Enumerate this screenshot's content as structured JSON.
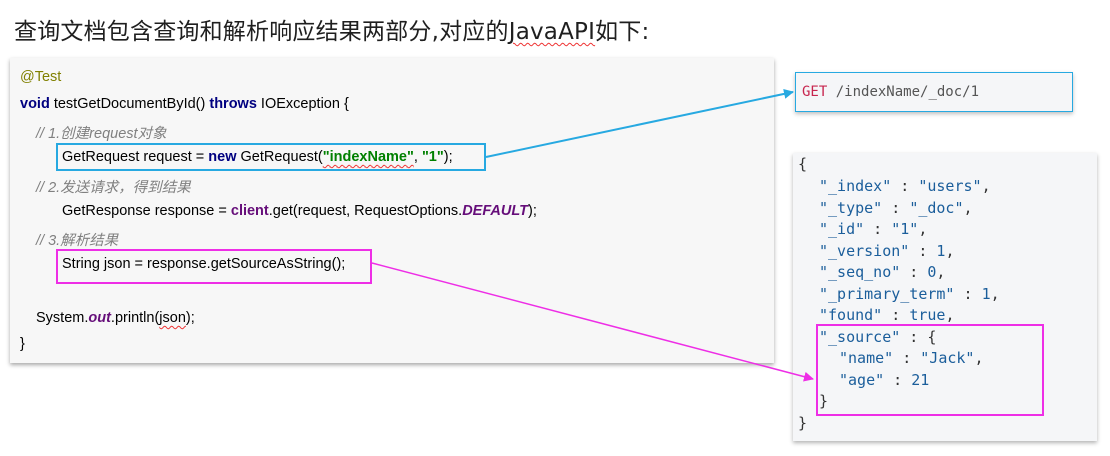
{
  "title": {
    "prefix": "查询文档包含查询和解析响应结果两部分,对应的",
    "api": "JavaAPI",
    "suffix": "如下:"
  },
  "code": {
    "annotation": "@Test",
    "kw_void": "void",
    "method_sig": " testGetDocumentById() ",
    "kw_throws": "throws",
    "exception": " IOException {",
    "comment1": "// 1.创建request对象",
    "l4_a": "GetRequest request = ",
    "kw_new": "new",
    "l4_b": " GetRequest(",
    "str_index": "\"indexName\"",
    "l4_c": ", ",
    "str_one": "\"1\"",
    "l4_d": ");",
    "comment2": "// 2.发送请求，得到结果",
    "l6_a": "GetResponse response = ",
    "l6_client": "client",
    "l6_b": ".get(request, RequestOptions.",
    "l6_default": "DEFAULT",
    "l6_c": ");",
    "comment3": "// 3.解析结果",
    "l8": "String json = response.getSourceAsString();",
    "l10_a": "System.",
    "l10_out": "out",
    "l10_b": ".println(",
    "l10_json": "json",
    "l10_c": ");",
    "close": "}"
  },
  "request": {
    "method": "GET",
    "path": " /indexName/_doc/1"
  },
  "response": {
    "open": "{",
    "index_key": "\"_index\"",
    "index_val": "\"users\"",
    "type_key": "\"_type\"",
    "type_val": "\"_doc\"",
    "id_key": "\"_id\"",
    "id_val": "\"1\"",
    "version_key": "\"_version\"",
    "version_val": "1",
    "seq_key": "\"_seq_no\"",
    "seq_val": "0",
    "primary_key": "\"_primary_term\"",
    "primary_val": "1",
    "found_key": "\"found\"",
    "found_val": "true",
    "source_key": "\"_source\"",
    "source_open": " : {",
    "name_key": "\"name\"",
    "name_val": "\"Jack\"",
    "age_key": "\"age\"",
    "age_val": "21",
    "source_close": "}",
    "close": "}"
  },
  "colors": {
    "blue_box": "#27a9e1",
    "pink_box": "#ee2ee6"
  }
}
